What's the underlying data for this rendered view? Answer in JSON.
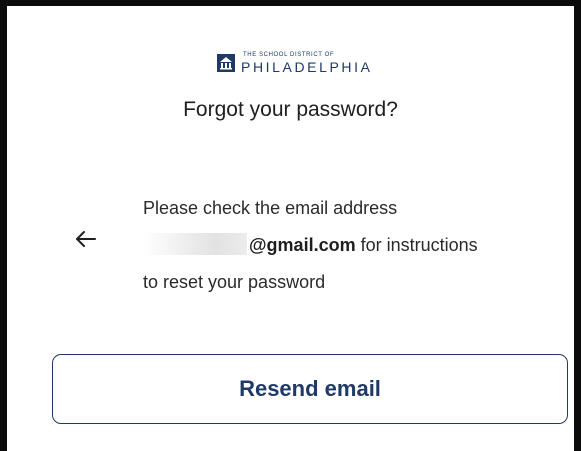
{
  "logo": {
    "top_line": "THE SCHOOL DISTRICT OF",
    "name": "PHILADELPHIA",
    "icon": "school-district-logo-icon"
  },
  "page": {
    "title": "Forgot your password?"
  },
  "nav": {
    "back_icon": "arrow-left-icon"
  },
  "message": {
    "line1": "Please check the email address",
    "email_redacted_label": "redacted email username",
    "email_domain": "@gmail.com",
    "line2_suffix": " for instructions",
    "line3": "to reset your password"
  },
  "actions": {
    "resend_label": "Resend email"
  },
  "colors": {
    "brand_navy": "#1f3a66",
    "frame_border": "#0b0b0b",
    "text": "#1f1f1f"
  }
}
